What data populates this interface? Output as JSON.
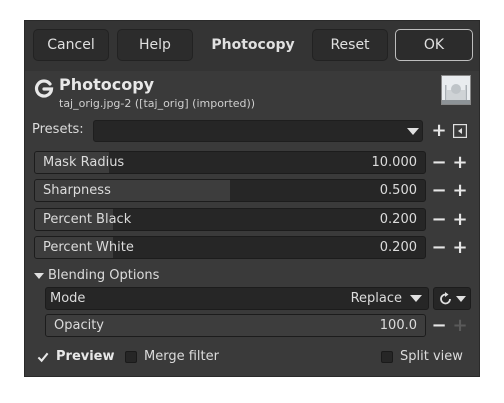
{
  "buttons": {
    "cancel": "Cancel",
    "help": "Help",
    "title": "Photocopy",
    "reset": "Reset",
    "ok": "OK"
  },
  "header": {
    "title": "Photocopy",
    "subtitle": "taj_orig.jpg-2 ([taj_orig] (imported))",
    "icon": "gimp-g-icon"
  },
  "presets": {
    "label": "Presets:",
    "value": ""
  },
  "params": [
    {
      "label": "Mask Radius",
      "value": "10.000",
      "fraction": 0.19
    },
    {
      "label": "Sharpness",
      "value": "0.500",
      "fraction": 0.5
    },
    {
      "label": "Percent Black",
      "value": "0.200",
      "fraction": 0.2
    },
    {
      "label": "Percent White",
      "value": "0.200",
      "fraction": 0.2
    }
  ],
  "blending": {
    "section_label": "Blending Options",
    "mode_label": "Mode",
    "mode_value": "Replace",
    "opacity_label": "Opacity",
    "opacity_value": "100.0",
    "opacity_fraction": 1.0
  },
  "footer": {
    "preview": "Preview",
    "merge": "Merge filter",
    "split": "Split view",
    "preview_checked": true,
    "merge_checked": false,
    "split_checked": false
  },
  "colors": {
    "dialog_bg": "#3a3a3a",
    "field_bg": "#262626",
    "text": "#dcdcdc"
  }
}
